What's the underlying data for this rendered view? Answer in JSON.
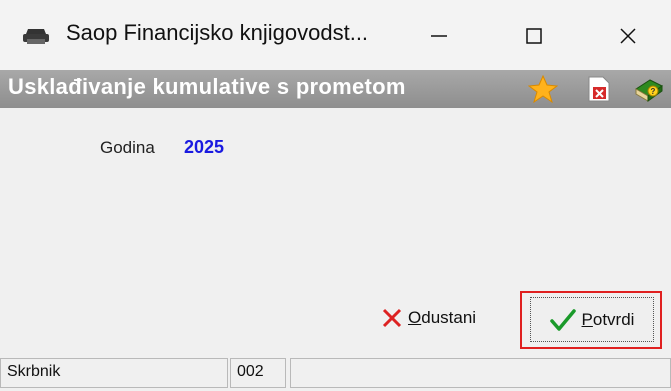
{
  "window": {
    "title": "Saop Financijsko knjigovodst...",
    "icons": [
      "printer-app-icon",
      "minimize-icon",
      "maximize-icon",
      "close-icon"
    ]
  },
  "header": {
    "title": "Usklađivanje kumulative s prometom",
    "icons": [
      "star-icon",
      "document-close-icon",
      "help-book-icon"
    ]
  },
  "form": {
    "year_label": "Godina",
    "year_value": "2025"
  },
  "buttons": {
    "cancel_underlined": "O",
    "cancel_rest": "dustani",
    "confirm_underlined": "P",
    "confirm_rest": "otvrdi"
  },
  "status_bar": {
    "user": "Skrbnik",
    "code": "002",
    "info": ""
  },
  "colors": {
    "header_gradient": "#9a9a9a",
    "year_value": "#1a1ae0",
    "highlight_outline": "#e02020"
  }
}
